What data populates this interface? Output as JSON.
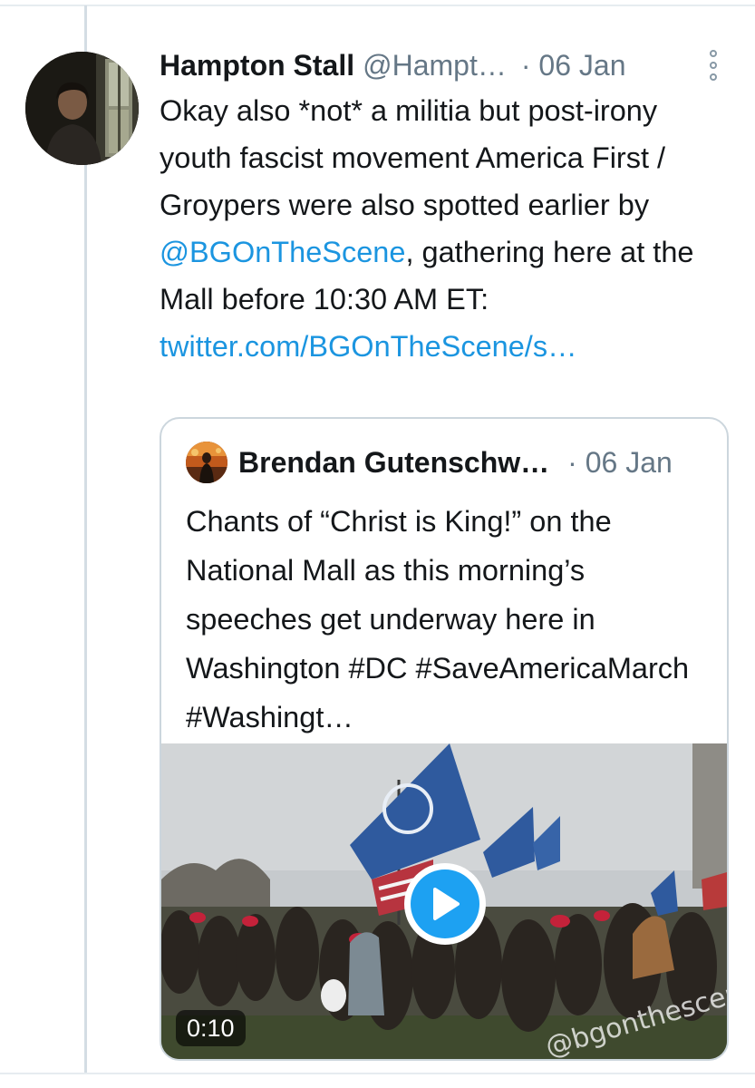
{
  "tweet": {
    "author_name": "Hampton Stall",
    "author_handle": "@Hampt…",
    "date": "· 06 Jan",
    "text_parts": {
      "before_mention": "Okay also *not* a militia but post-irony youth fascist movement America First / Groypers were also spotted earlier by ",
      "mention": "@BGOnTheScene",
      "after_mention": ", gathering here at the Mall before 10:30 AM ET:",
      "link": "twitter.com/BGOnTheScene/s…"
    }
  },
  "quoted_tweet": {
    "author_name": "Brendan Gutenschw…",
    "date": "· 06 Jan",
    "text": "Chants of “Christ is King!” on the National Mall as this morning’s speeches get underway here in Washington #DC #SaveAmericaMarch #Washingt…",
    "video": {
      "duration": "0:10",
      "watermark": "@bgonthescene"
    }
  },
  "icons": {
    "more": "more-vertical-icon",
    "play": "play-icon"
  },
  "colors": {
    "link": "#1b95e0",
    "secondary_text": "#657786",
    "play_button": "#1da1f2",
    "border": "#ccd6dd"
  }
}
